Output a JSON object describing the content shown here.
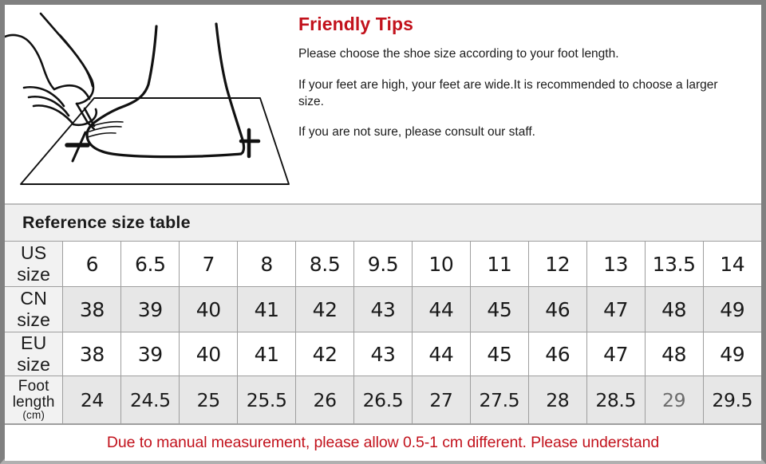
{
  "illustration": {
    "alt_name": "foot-measure-illustration",
    "description": "Line drawing of a hand holding a pencil marking the length of a bare foot standing on a sheet of paper"
  },
  "tips": {
    "title": "Friendly Tips",
    "paragraphs": [
      "Please choose the shoe size according to your foot length.",
      "If your feet are high, your feet are wide.It is recommended to choose a larger size.",
      "If you are not sure, please consult our staff."
    ]
  },
  "table": {
    "title": "Reference size table",
    "rows": [
      {
        "label": "US size",
        "unit": "",
        "values": [
          "6",
          "6.5",
          "7",
          "8",
          "8.5",
          "9.5",
          "10",
          "11",
          "12",
          "13",
          "13.5",
          "14"
        ]
      },
      {
        "label": "CN size",
        "unit": "",
        "values": [
          "38",
          "39",
          "40",
          "41",
          "42",
          "43",
          "44",
          "45",
          "46",
          "47",
          "48",
          "49"
        ]
      },
      {
        "label": "EU size",
        "unit": "",
        "values": [
          "38",
          "39",
          "40",
          "41",
          "42",
          "43",
          "44",
          "45",
          "46",
          "47",
          "48",
          "49"
        ]
      },
      {
        "label": "Foot length",
        "unit": "(cm)",
        "values": [
          "24",
          "24.5",
          "25",
          "25.5",
          "26",
          "26.5",
          "27",
          "27.5",
          "28",
          "28.5",
          "29",
          "29.5"
        ]
      }
    ]
  },
  "footer": {
    "note": "Due to manual measurement, please allow 0.5-1 cm different. Please understand"
  },
  "colors": {
    "accent_red": "#c2121c",
    "frame_gray": "#808080",
    "cell_gray": "#e7e7e7",
    "label_gray": "#f2f2f2",
    "grid_line": "#9e9e9e"
  }
}
